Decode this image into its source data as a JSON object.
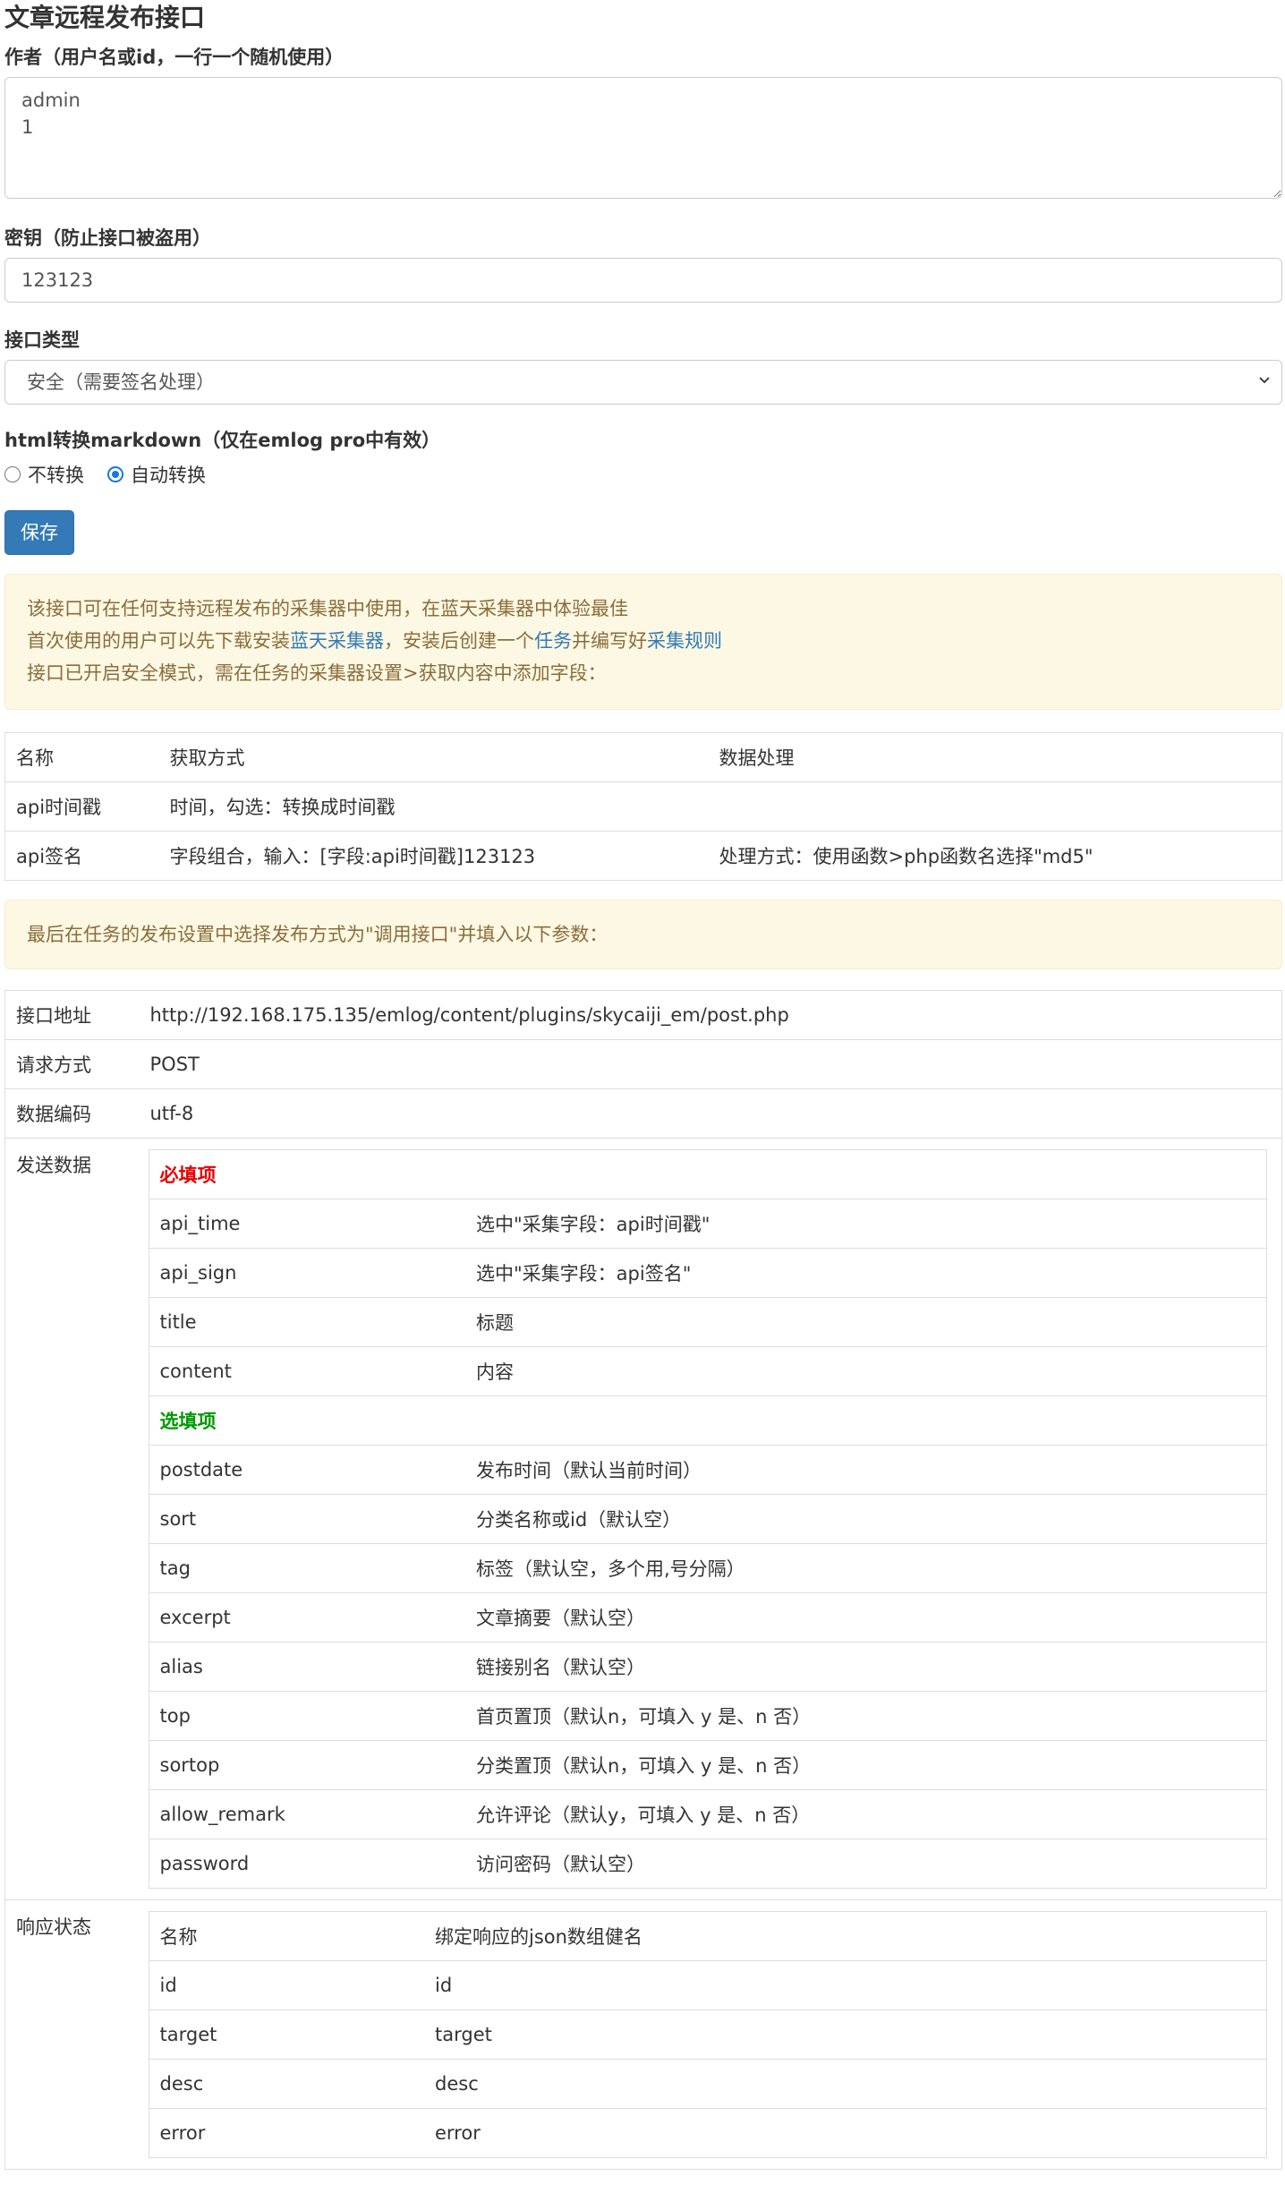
{
  "title": "文章远程发布接口",
  "author": {
    "label": "作者（用户名或id，一行一个随机使用）",
    "value": "admin\n1"
  },
  "secret": {
    "label": "密钥（防止接口被盗用）",
    "value": "123123"
  },
  "api_type": {
    "label": "接口类型",
    "selected": "安全（需要签名处理）"
  },
  "markdown": {
    "label": "html转换markdown（仅在emlog pro中有效）",
    "options": [
      {
        "label": "不转换",
        "checked": false
      },
      {
        "label": "自动转换",
        "checked": true
      }
    ]
  },
  "save_label": "保存",
  "notice": {
    "line1": "该接口可在任何支持远程发布的采集器中使用，在蓝天采集器中体验最佳",
    "line2_a": "首次使用的用户可以先下载安装",
    "line2_link1": "蓝天采集器",
    "line2_b": "，安装后创建一个",
    "line2_link2": "任务",
    "line2_c": "并编写好",
    "line2_link3": "采集规则",
    "line3": "接口已开启安全模式，需在任务的采集器设置>获取内容中添加字段："
  },
  "fields_table": {
    "headers": [
      "名称",
      "获取方式",
      "数据处理"
    ],
    "rows": [
      [
        "api时间戳",
        "时间，勾选：转换成时间戳",
        ""
      ],
      [
        "api签名",
        "字段组合，输入：[字段:api时间戳]123123",
        "处理方式：使用函数>php函数名选择\"md5\""
      ]
    ]
  },
  "notice2": "最后在任务的发布设置中选择发布方式为\"调用接口\"并填入以下参数：",
  "api": {
    "url_label": "接口地址",
    "url": "http://192.168.175.135/emlog/content/plugins/skycaiji_em/post.php",
    "method_label": "请求方式",
    "method": "POST",
    "encoding_label": "数据编码",
    "encoding": "utf-8",
    "send_label": "发送数据",
    "required_title": "必填项",
    "required": [
      [
        "api_time",
        "选中\"采集字段：api时间戳\""
      ],
      [
        "api_sign",
        "选中\"采集字段：api签名\""
      ],
      [
        "title",
        "标题"
      ],
      [
        "content",
        "内容"
      ]
    ],
    "optional_title": "选填项",
    "optional": [
      [
        "postdate",
        "发布时间（默认当前时间）"
      ],
      [
        "sort",
        "分类名称或id（默认空）"
      ],
      [
        "tag",
        "标签（默认空，多个用,号分隔）"
      ],
      [
        "excerpt",
        "文章摘要（默认空）"
      ],
      [
        "alias",
        "链接别名（默认空）"
      ],
      [
        "top",
        "首页置顶（默认n，可填入 y 是、n 否）"
      ],
      [
        "sortop",
        "分类置顶（默认n，可填入 y 是、n 否）"
      ],
      [
        "allow_remark",
        "允许评论（默认y，可填入 y 是、n 否）"
      ],
      [
        "password",
        "访问密码（默认空）"
      ]
    ],
    "response_label": "响应状态",
    "response_headers": [
      "名称",
      "绑定响应的json数组健名"
    ],
    "response": [
      [
        "id",
        "id"
      ],
      [
        "target",
        "target"
      ],
      [
        "desc",
        "desc"
      ],
      [
        "error",
        "error"
      ]
    ]
  }
}
